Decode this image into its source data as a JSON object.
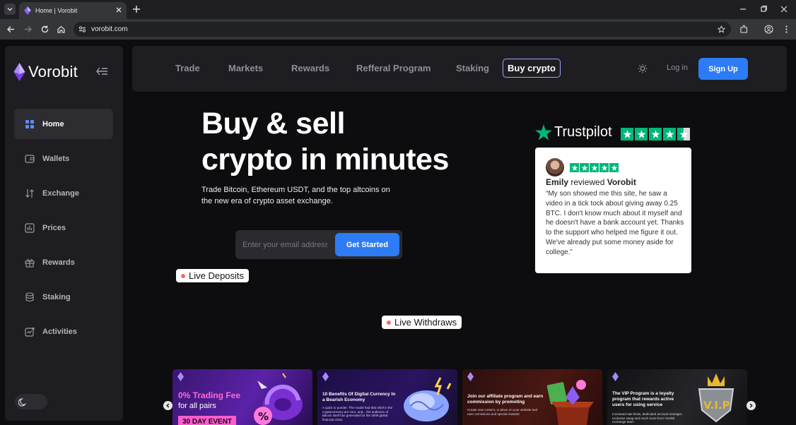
{
  "browser": {
    "tab_title": "Home | Vorobit",
    "url": "vorobit.com"
  },
  "sidebar": {
    "brand": "Vorobit",
    "items": [
      {
        "label": "Home",
        "icon": "grid-icon"
      },
      {
        "label": "Wallets",
        "icon": "wallet-icon"
      },
      {
        "label": "Exchange",
        "icon": "exchange-icon"
      },
      {
        "label": "Prices",
        "icon": "chart-icon"
      },
      {
        "label": "Rewards",
        "icon": "gift-icon"
      },
      {
        "label": "Staking",
        "icon": "database-icon"
      },
      {
        "label": "Activities",
        "icon": "activity-icon"
      }
    ]
  },
  "nav": {
    "links": [
      "Trade",
      "Markets",
      "Rewards",
      "Refferal Program",
      "Staking"
    ],
    "buy_crypto": "Buy crypto",
    "login": "Log in",
    "signup": "Sign Up"
  },
  "hero": {
    "title_line1": "Buy & sell",
    "title_line2": "crypto in minutes",
    "subtitle": "Trade Bitcoin, Ethereum USDT, and the top altcoins on the new era of crypto asset exchange.",
    "email_placeholder": "Enter your email address",
    "cta": "Get Started",
    "live_deposits": "Live Deposits",
    "live_withdraws": "Live Withdraws"
  },
  "trustpilot": {
    "brand": "Trustpilot",
    "rating": 4.5,
    "review": {
      "name": "Emily",
      "reviewed": "reviewed",
      "company": "Vorobit",
      "text": "“My son showed me this site, he saw a video in a tick tock about giving away 0.25 BTC. I don't know much about it myself and he doesn't have a bank account yet. Thanks to the support who helped me figure it out. We've already put some money aside for college.”"
    }
  },
  "promos": [
    {
      "big": "0% Trading Fee",
      "small": "for all pairs",
      "badge": "30 DAY EVENT"
    },
    {
      "title": "10 Benefits Of Digital Currency In a Bearish Economy",
      "body": "A quick to ponder: The model had that relief in the cryptocurrency are zero, and... the audience of Bitcoin itself has generated for the 2008 global financial crisis."
    },
    {
      "title": "Join our affiliate program and earn commission by promoting",
      "body": "Create new content, or place on your website and earn comissions and special rewards"
    },
    {
      "title": "The VIP Program is a loyalty program that rewards active users for using service",
      "body": "Increased rate limits, dedicated account manager, exclusive swag and much more from Vorobit exchange team"
    }
  ]
}
